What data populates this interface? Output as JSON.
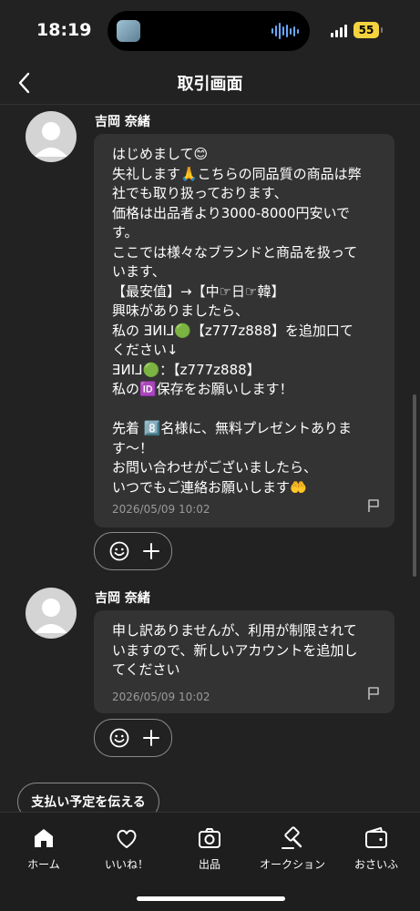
{
  "status": {
    "time": "18:19",
    "battery": "55"
  },
  "nav": {
    "title": "取引画面"
  },
  "messages": [
    {
      "sender": "吉岡 奈緒",
      "text": "はじめまして😊\n失礼します🙏こちらの同品質の商品は弊社でも取り扱っております、\n価格は出品者より3000-8000円安いです。\nここでは様々なブランドと商品を扱っています、\n【最安值】→【中☞日☞韓】\n興味がありましたら、\n私の ƎИI⅃🟢【z777z888】を追加口てください↓\nƎИI⅃🟢：【z777z888】\n私の🆔保存をお願いします！\n\n先着 8️⃣名様に、無料プレゼントあります～！\nお問い合わせがございましたら、\nいつでもご連絡お願いします🤲",
      "timestamp": "2026/05/09 10:02"
    },
    {
      "sender": "吉岡 奈緒",
      "text": "申し訳ありませんが、利用が制限されていますので、新しいアカウントを追加してください",
      "timestamp": "2026/05/09 10:02"
    }
  ],
  "payment_button": "支払い予定を伝える",
  "tabs": [
    {
      "label": "ホーム",
      "icon": "home-icon"
    },
    {
      "label": "いいね！",
      "icon": "heart-icon"
    },
    {
      "label": "出品",
      "icon": "camera-icon"
    },
    {
      "label": "オークション",
      "icon": "gavel-icon"
    },
    {
      "label": "おさいふ",
      "icon": "wallet-icon"
    }
  ]
}
